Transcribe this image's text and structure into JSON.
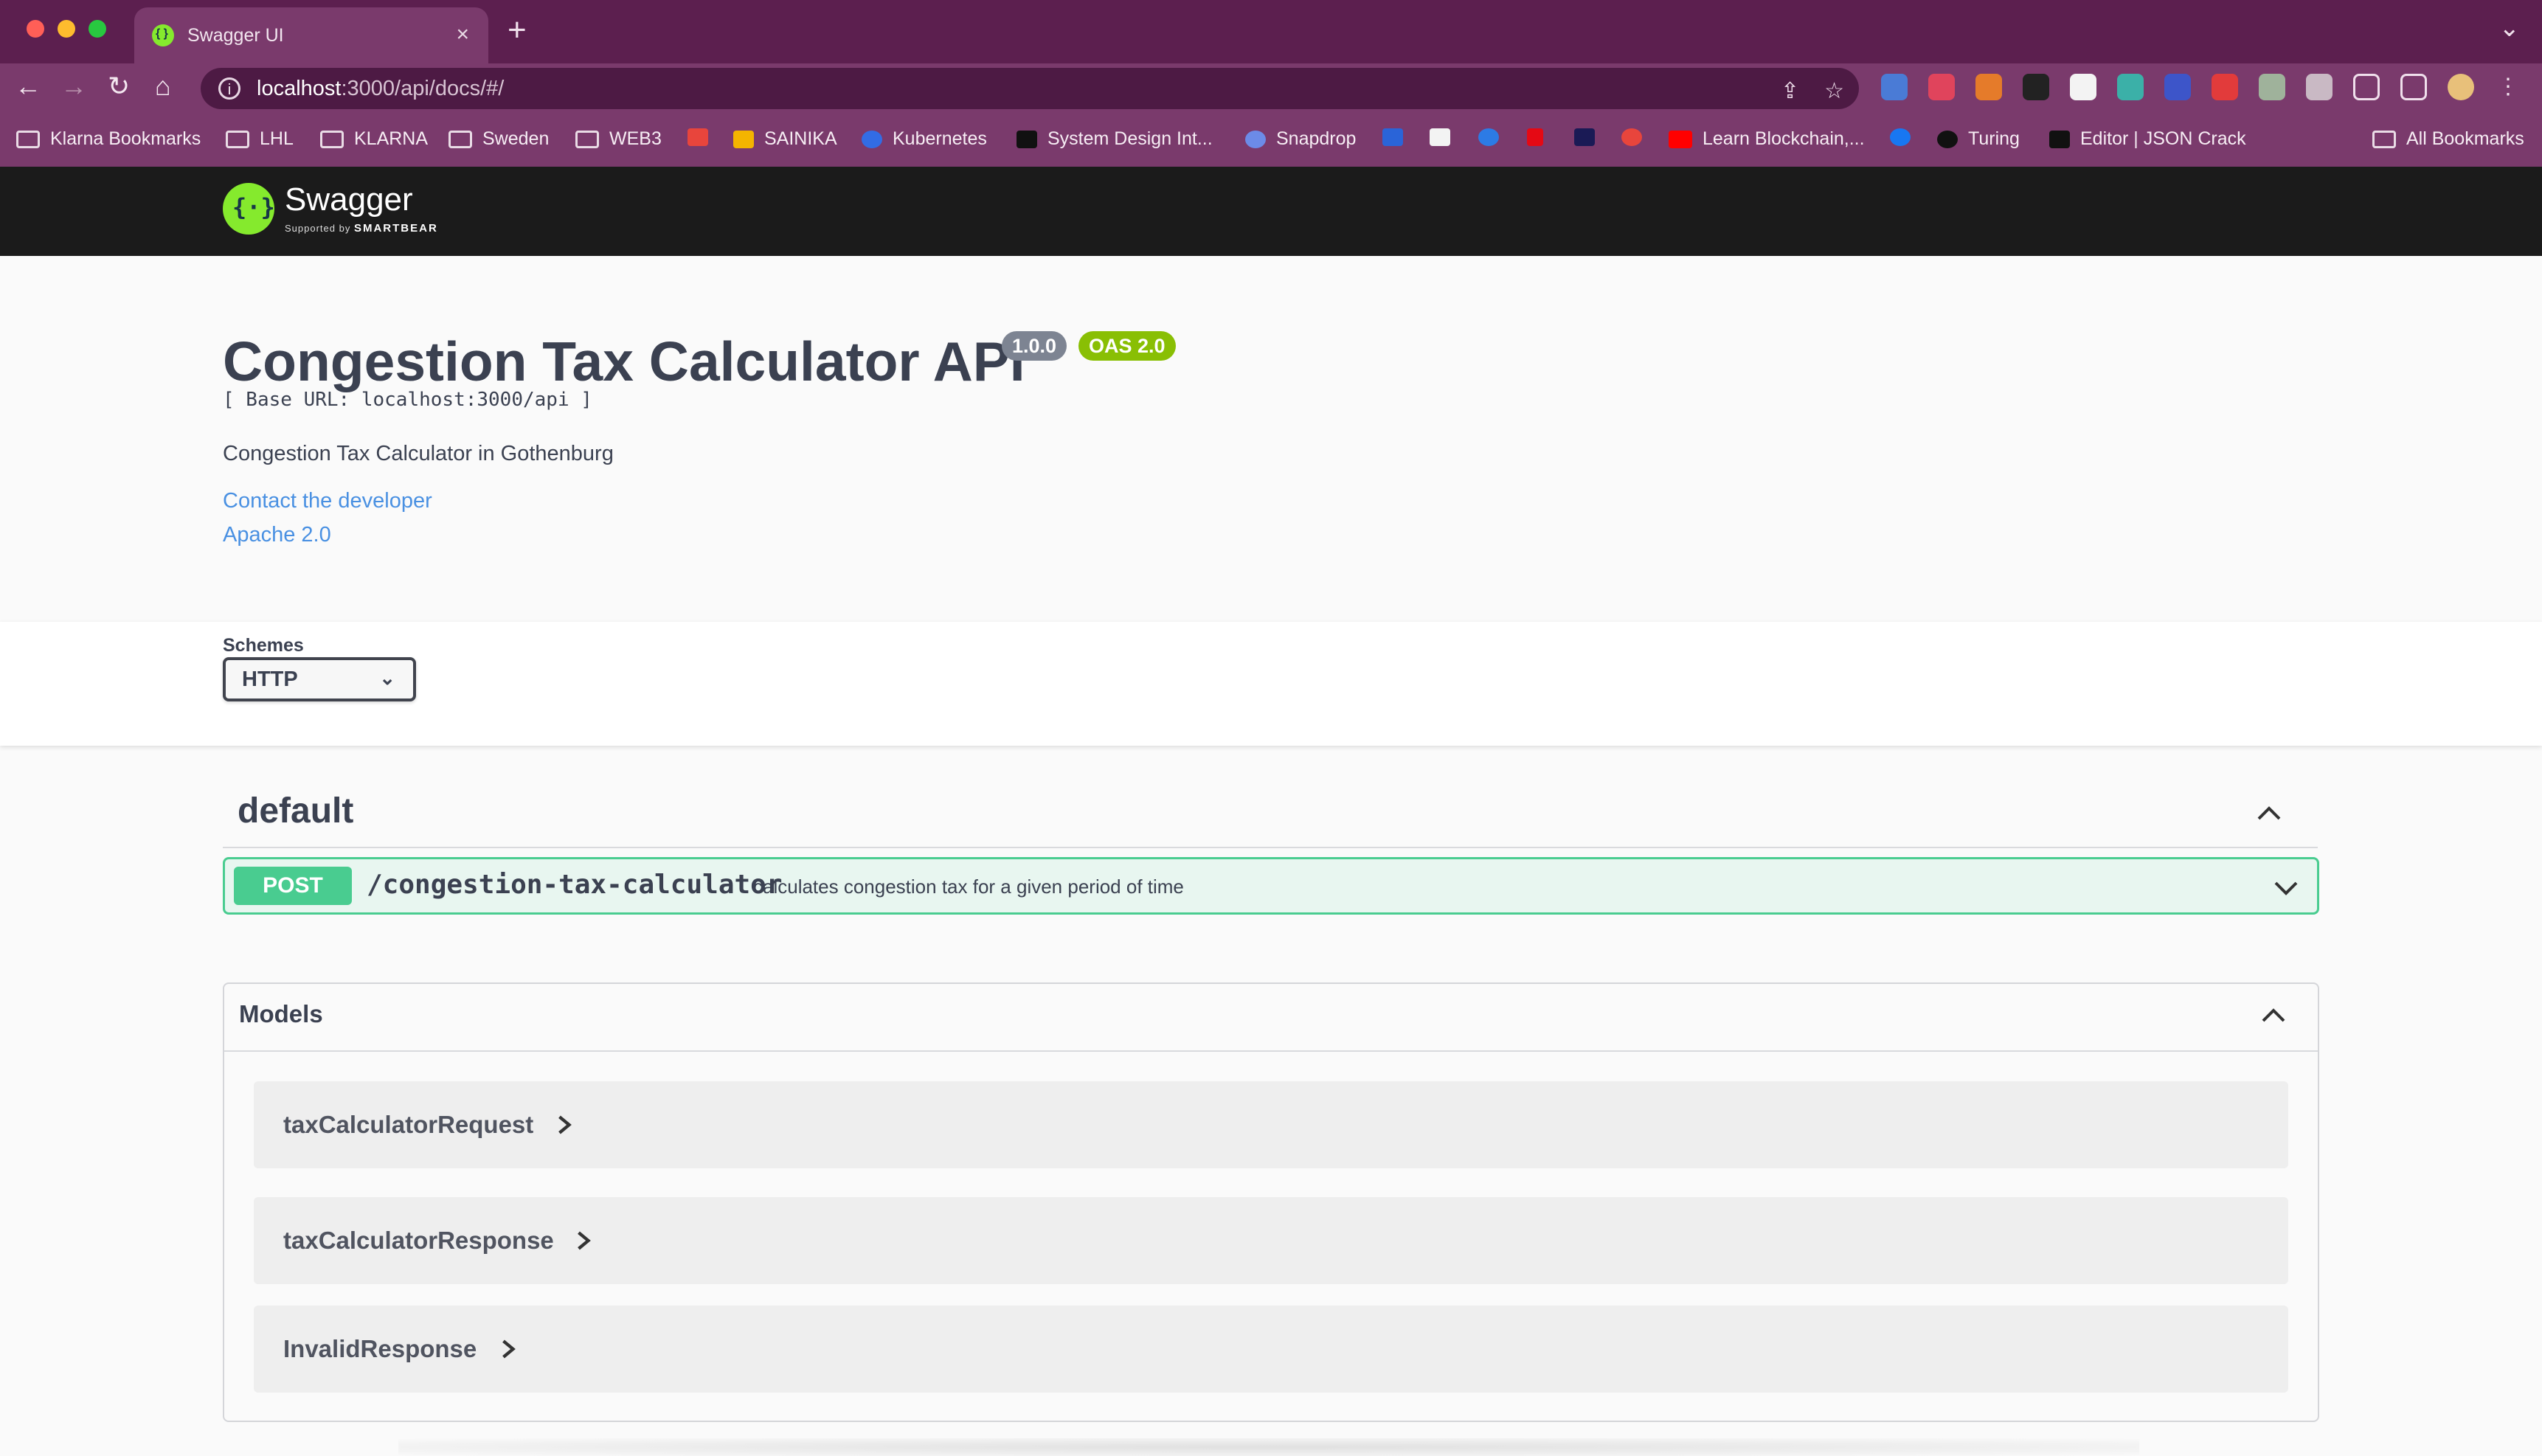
{
  "browser": {
    "tab_title": "Swagger UI",
    "url_host": "localhost",
    "url_path": ":3000/api/docs/#/",
    "bookmarks": [
      "Klarna Bookmarks",
      "LHL",
      "KLARNA",
      "Sweden",
      "WEB3",
      "SAINIKA",
      "Kubernetes",
      "System Design Int...",
      "Snapdrop",
      "Learn Blockchain,...",
      "Turing",
      "Editor | JSON Crack",
      "All Bookmarks"
    ]
  },
  "swagger": {
    "logo_title": "Swagger",
    "logo_sub_prefix": "Supported by",
    "logo_sub_brand": "SMARTBEAR"
  },
  "info": {
    "title": "Congestion Tax Calculator API",
    "version_badge": "1.0.0",
    "oas_badge": "OAS 2.0",
    "base_url": "[ Base URL: localhost:3000/api ]",
    "description": "Congestion Tax Calculator in Gothenburg",
    "contact_link": "Contact the developer",
    "license_link": "Apache 2.0"
  },
  "schemes": {
    "label": "Schemes",
    "selected": "HTTP"
  },
  "tag": {
    "name": "default"
  },
  "operation": {
    "method": "POST",
    "path": "/congestion-tax-calculator",
    "summary": "calculates congestion tax for a given period of time"
  },
  "models": {
    "title": "Models",
    "items": [
      "taxCalculatorRequest",
      "taxCalculatorResponse",
      "InvalidResponse"
    ]
  },
  "colors": {
    "browser_frame": "#5c1f4f",
    "swagger_green": "#85ea2d",
    "post_green": "#49cc90",
    "link_blue": "#4990e2",
    "version_badge": "#7d8492",
    "oas_badge": "#89bf04"
  }
}
